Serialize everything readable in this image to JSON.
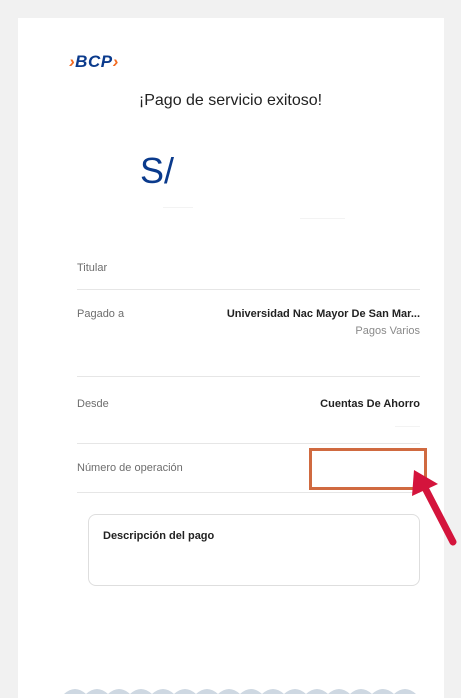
{
  "brand": {
    "logo_text": "BCP",
    "logo_left_chevron": "›",
    "logo_right_chevron": "›"
  },
  "headline": "¡Pago de servicio exitoso!",
  "amount": {
    "currency": "S/"
  },
  "details": {
    "titular_label": "Titular",
    "pagado_a_label": "Pagado a",
    "pagado_a_value": "Universidad Nac Mayor De San Mar...",
    "pagado_a_sub": "Pagos Varios",
    "desde_label": "Desde",
    "desde_value": "Cuentas De Ahorro",
    "numero_operacion_label": "Número de operación"
  },
  "description_card": {
    "title": "Descripción del pago"
  },
  "colors": {
    "brand_blue": "#0a3a8c",
    "brand_orange": "#f26b22",
    "highlight_border": "#d06a40",
    "arrow": "#d4143c"
  },
  "icons": {
    "annotation_arrow": "pointer-arrow-icon"
  }
}
